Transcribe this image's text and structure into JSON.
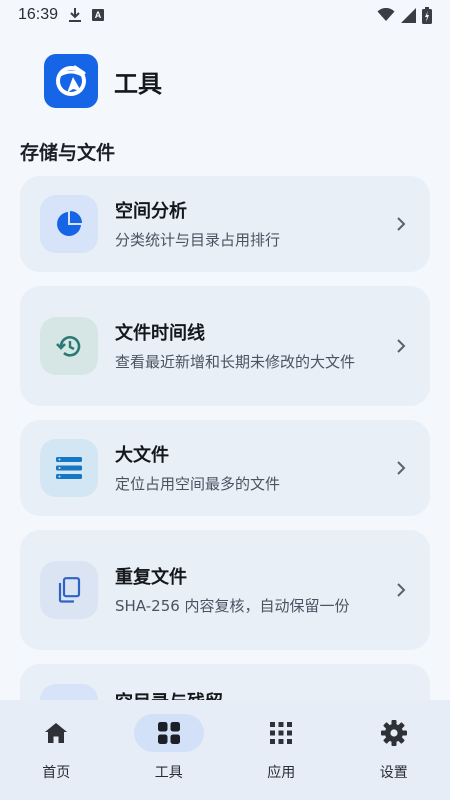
{
  "status_bar": {
    "time": "16:39",
    "a_badge": "A"
  },
  "header": {
    "title": "工具"
  },
  "section": {
    "title": "存储与文件"
  },
  "items": [
    {
      "title": "空间分析",
      "subtitle": "分类统计与目录占用排行",
      "icon": "pie-chart-icon"
    },
    {
      "title": "文件时间线",
      "subtitle": "查看最近新增和长期未修改的大文件",
      "icon": "history-icon"
    },
    {
      "title": "大文件",
      "subtitle": "定位占用空间最多的文件",
      "icon": "storage-list-icon"
    },
    {
      "title": "重复文件",
      "subtitle": "SHA-256 内容复核，自动保留一份",
      "icon": "copy-icon"
    },
    {
      "title": "空目录与残留",
      "subtitle": "",
      "icon": "folder-icon"
    }
  ],
  "nav": [
    {
      "label": "首页",
      "icon": "home-icon",
      "active": false
    },
    {
      "label": "工具",
      "icon": "tools-grid-icon",
      "active": true
    },
    {
      "label": "应用",
      "icon": "apps-icon",
      "active": false
    },
    {
      "label": "设置",
      "icon": "settings-icon",
      "active": false
    }
  ],
  "colors": {
    "accent": "#1565e6",
    "teal": "#2a7a73",
    "card_bg": "#e9eff7",
    "nav_bg": "#e6edf6",
    "active_pill": "#d2e1f8"
  }
}
